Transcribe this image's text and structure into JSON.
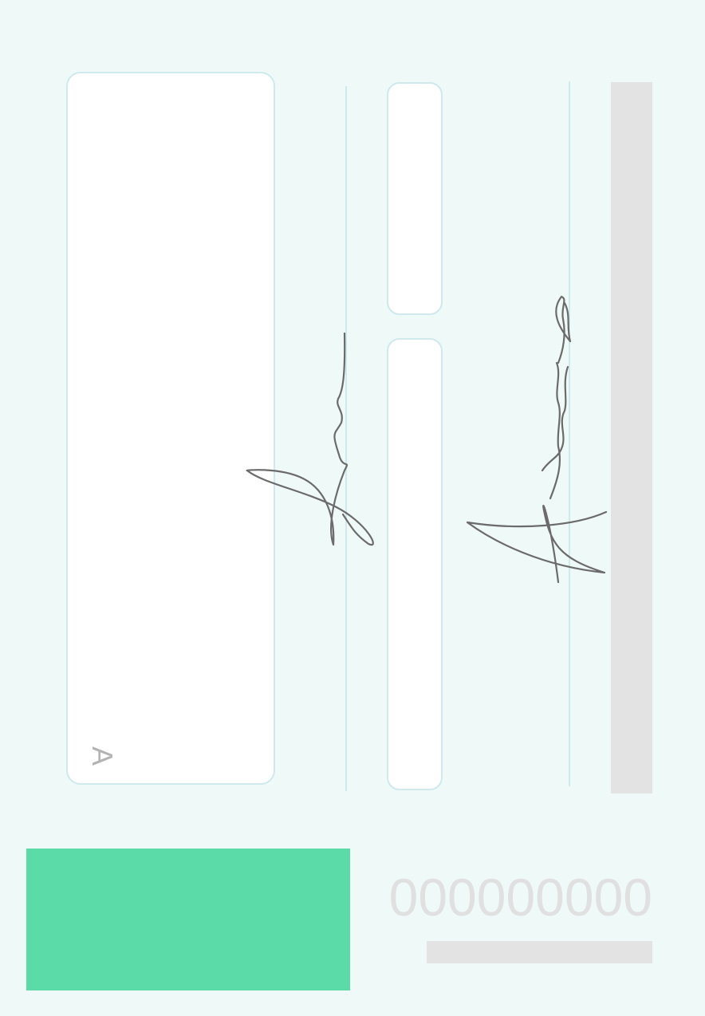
{
  "document": {
    "corner_marker": "A",
    "number_text": "000000000",
    "signatures": [
      "signature-1",
      "signature-2"
    ],
    "colors": {
      "background": "#eef9f8",
      "box_border": "#cfe9ec",
      "accent_block": "#5bdba8",
      "placeholder_grey": "#e3e3e3",
      "ink": "#666666"
    }
  }
}
